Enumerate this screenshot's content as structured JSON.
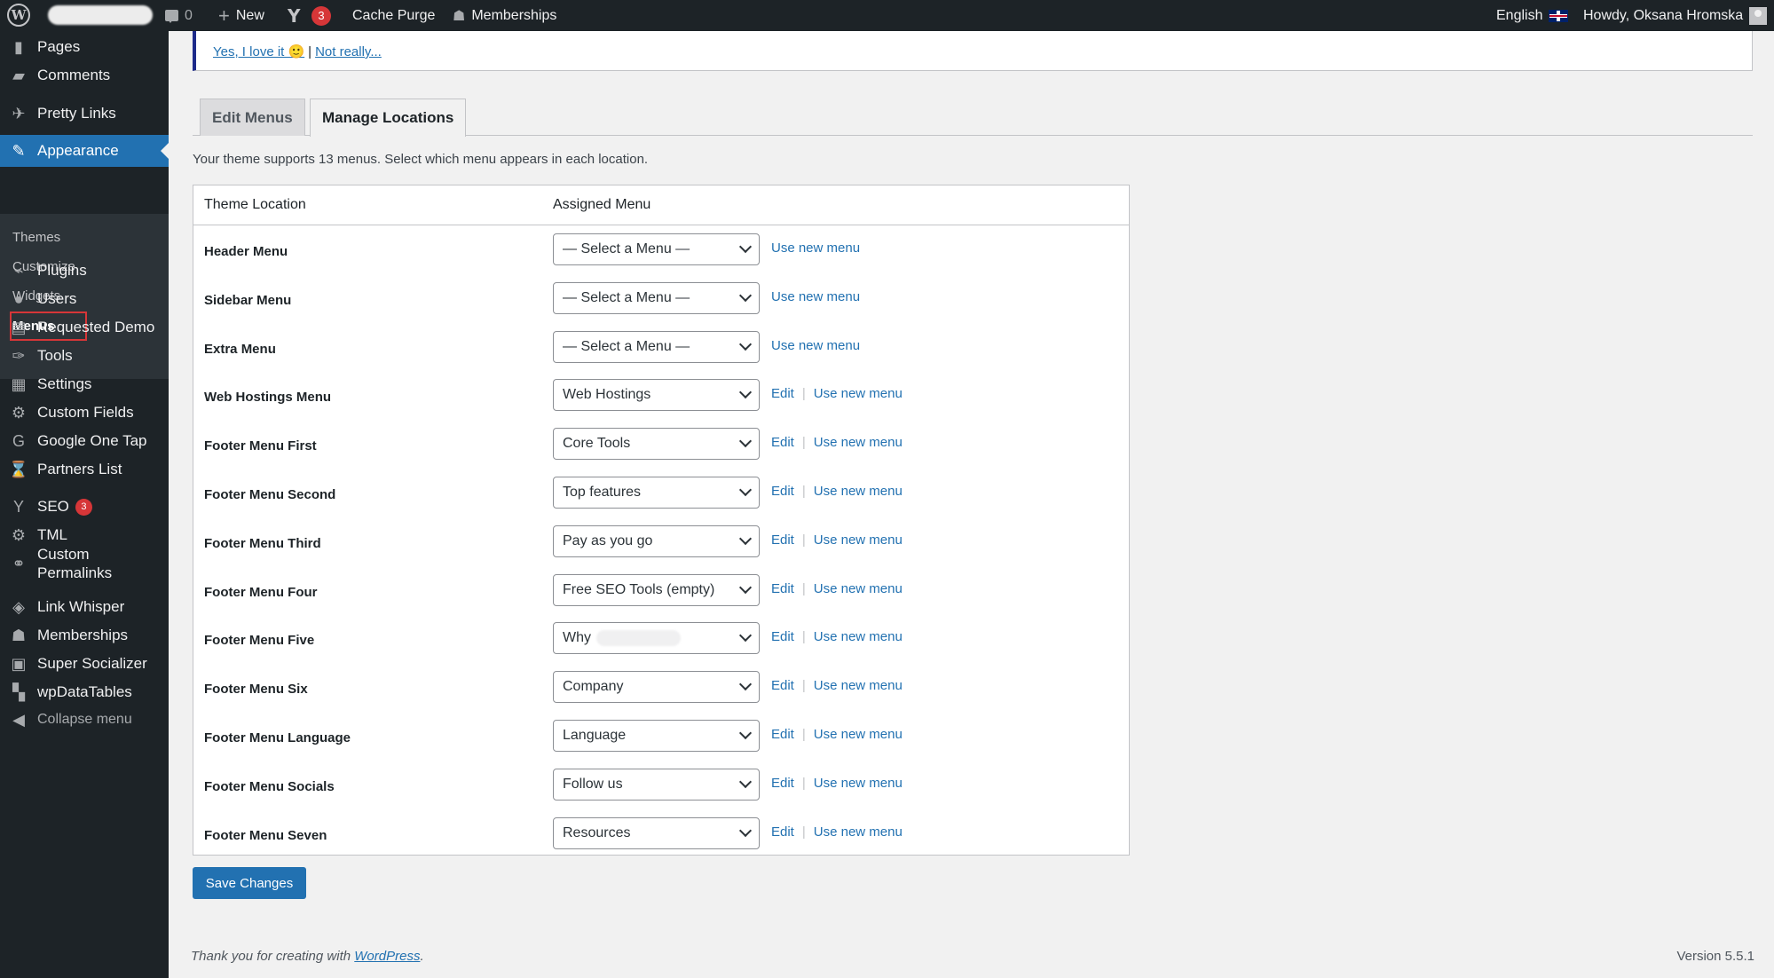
{
  "adminbar": {
    "comments_count": "0",
    "new_label": "New",
    "yoast_badge": "3",
    "cache_purge": "Cache Purge",
    "memberships": "Memberships",
    "language": "English",
    "howdy": "Howdy, Oksana Hromska"
  },
  "sidebar": {
    "items": [
      {
        "label": "Pages",
        "icon": "pages-icon",
        "glyph": "▮"
      },
      {
        "label": "Comments",
        "icon": "comments-icon",
        "glyph": "▰"
      },
      {
        "label": "Pretty Links",
        "icon": "pretty-links-icon",
        "glyph": "✈"
      },
      {
        "label": "Appearance",
        "icon": "appearance-icon",
        "glyph": "✎"
      },
      {
        "label": "Plugins",
        "icon": "plugins-icon",
        "glyph": "⌁"
      },
      {
        "label": "Users",
        "icon": "users-icon",
        "glyph": "●"
      },
      {
        "label": "Requested Demo",
        "icon": "requested-demo-icon",
        "glyph": "▤"
      },
      {
        "label": "Tools",
        "icon": "tools-icon",
        "glyph": "✑"
      },
      {
        "label": "Settings",
        "icon": "settings-icon",
        "glyph": "▦"
      },
      {
        "label": "Custom Fields",
        "icon": "custom-fields-icon",
        "glyph": "⚙"
      },
      {
        "label": "Google One Tap",
        "icon": "google-icon",
        "glyph": "G"
      },
      {
        "label": "Partners List",
        "icon": "partners-list-icon",
        "glyph": "⌛"
      },
      {
        "label": "SEO",
        "icon": "yoast-seo-icon",
        "glyph": "Y",
        "badge": "3"
      },
      {
        "label": "TML",
        "icon": "tml-gear-icon",
        "glyph": "⚙"
      },
      {
        "label": "Custom Permalinks",
        "icon": "permalinks-icon",
        "glyph": "⚭"
      },
      {
        "label": "Link Whisper",
        "icon": "link-whisper-icon",
        "glyph": "◈"
      },
      {
        "label": "Memberships",
        "icon": "memberships-icon",
        "glyph": "☗"
      },
      {
        "label": "Super Socializer",
        "icon": "super-socializer-icon",
        "glyph": "▣"
      },
      {
        "label": "wpDataTables",
        "icon": "wpdatatables-icon",
        "glyph": "▚"
      },
      {
        "label": "Collapse menu",
        "icon": "collapse-icon",
        "glyph": "◀"
      }
    ],
    "submenu": [
      "Themes",
      "Customize",
      "Widgets",
      "Menus"
    ]
  },
  "notice": {
    "yes_link": "Yes, I love it 🙂",
    "separator": "|",
    "no_link": "Not really..."
  },
  "tabs": {
    "edit_menus": "Edit Menus",
    "manage_locations": "Manage Locations"
  },
  "description": "Your theme supports 13 menus. Select which menu appears in each location.",
  "table": {
    "col_location": "Theme Location",
    "col_menu": "Assigned Menu",
    "edit_label": "Edit",
    "use_new_label": "Use new menu",
    "rows": [
      {
        "location": "Header Menu",
        "menu": "— Select a Menu —"
      },
      {
        "location": "Sidebar Menu",
        "menu": "— Select a Menu —"
      },
      {
        "location": "Extra Menu",
        "menu": "— Select a Menu —"
      },
      {
        "location": "Web Hostings Menu",
        "menu": "Web Hostings"
      },
      {
        "location": "Footer Menu First",
        "menu": "Core Tools"
      },
      {
        "location": "Footer Menu Second",
        "menu": "Top features"
      },
      {
        "location": "Footer Menu Third",
        "menu": "Pay as you go"
      },
      {
        "location": "Footer Menu Four",
        "menu": "Free SEO Tools (empty)"
      },
      {
        "location": "Footer Menu Five",
        "menu": "Why"
      },
      {
        "location": "Footer Menu Six",
        "menu": "Company"
      },
      {
        "location": "Footer Menu Language",
        "menu": "Language"
      },
      {
        "location": "Footer Menu Socials",
        "menu": "Follow us"
      },
      {
        "location": "Footer Menu Seven",
        "menu": "Resources"
      }
    ]
  },
  "save_label": "Save Changes",
  "footer": {
    "thanks": "Thank you for creating with",
    "wp_link": "WordPress",
    "period": ".",
    "version": "Version 5.5.1"
  }
}
